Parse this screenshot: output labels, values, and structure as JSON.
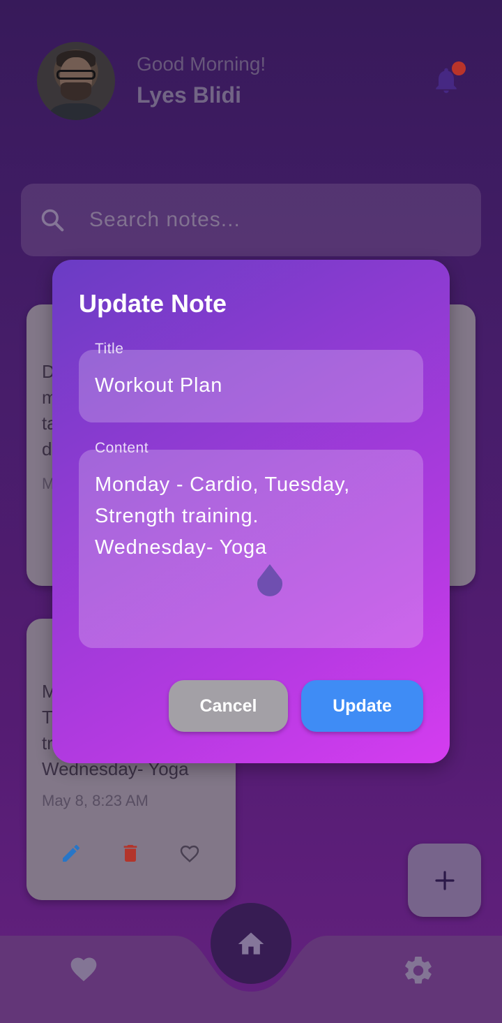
{
  "header": {
    "greeting": "Good Morning!",
    "user_name": "Lyes Blidi"
  },
  "search": {
    "placeholder": "Search notes..."
  },
  "notes": [
    {
      "text": "D\nm\nta\nd",
      "date": "M"
    },
    {
      "text": "M\nT\ntr\nWednesday- Yoga",
      "date": "May 8, 8:23 AM"
    }
  ],
  "dialog": {
    "title": "Update Note",
    "title_label": "Title",
    "title_value": "Workout Plan",
    "content_label": "Content",
    "content_value": "Monday - Cardio, Tuesday,\nStrength training.\nWednesday- Yoga",
    "cancel_label": "Cancel",
    "update_label": "Update"
  },
  "colors": {
    "accent": "#3f8cf5",
    "dialog_start": "#6a3cc4",
    "dialog_end": "#d53cf0",
    "cancel": "#a3a0a6",
    "delete": "#c0392b",
    "edit": "#2a7fd4"
  },
  "icons": {
    "notification": "bell-icon",
    "search": "search-icon",
    "edit": "pencil-icon",
    "delete": "trash-icon",
    "favorite": "heart-outline-icon",
    "add": "plus-icon",
    "nav_favorites": "heart-icon",
    "nav_home": "home-icon",
    "nav_settings": "gear-icon"
  }
}
